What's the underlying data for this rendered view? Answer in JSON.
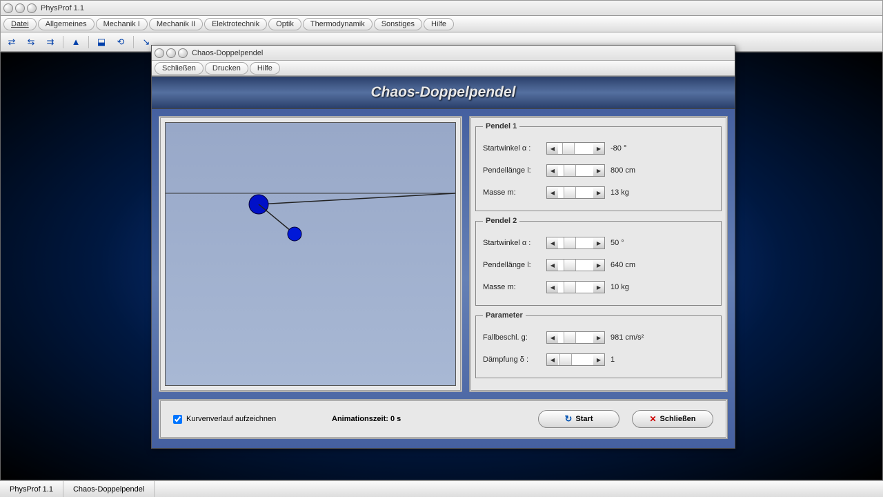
{
  "main_window": {
    "title": "PhysProf 1.1"
  },
  "menubar": {
    "items": [
      "Datei",
      "Allgemeines",
      "Mechanik I",
      "Mechanik II",
      "Elektrotechnik",
      "Optik",
      "Thermodynamik",
      "Sonstiges",
      "Hilfe"
    ]
  },
  "sub_window": {
    "title": "Chaos-Doppelpendel",
    "menu": [
      "Schließen",
      "Drucken",
      "Hilfe"
    ],
    "banner": "Chaos-Doppelpendel"
  },
  "pendel1": {
    "legend": "Pendel 1",
    "startwinkel": {
      "label": "Startwinkel α :",
      "value": "-80 °"
    },
    "laenge": {
      "label": "Pendellänge l:",
      "value": "800 cm"
    },
    "masse": {
      "label": "Masse m:",
      "value": "13 kg"
    }
  },
  "pendel2": {
    "legend": "Pendel 2",
    "startwinkel": {
      "label": "Startwinkel α :",
      "value": "50 °"
    },
    "laenge": {
      "label": "Pendellänge l:",
      "value": "640 cm"
    },
    "masse": {
      "label": "Masse m:",
      "value": "10 kg"
    }
  },
  "parameter": {
    "legend": "Parameter",
    "g": {
      "label": "Fallbeschl. g:",
      "value": "981 cm/s²"
    },
    "damp": {
      "label": "Dämpfung δ :",
      "value": "1"
    }
  },
  "bottom": {
    "checkbox": "Kurvenverlauf aufzeichnen",
    "anim_label": "Animationszeit:",
    "anim_value": "0 s",
    "start": "Start",
    "close": "Schließen"
  },
  "statusbar": {
    "cell1": "PhysProf 1.1",
    "cell2": "Chaos-Doppelpendel"
  }
}
